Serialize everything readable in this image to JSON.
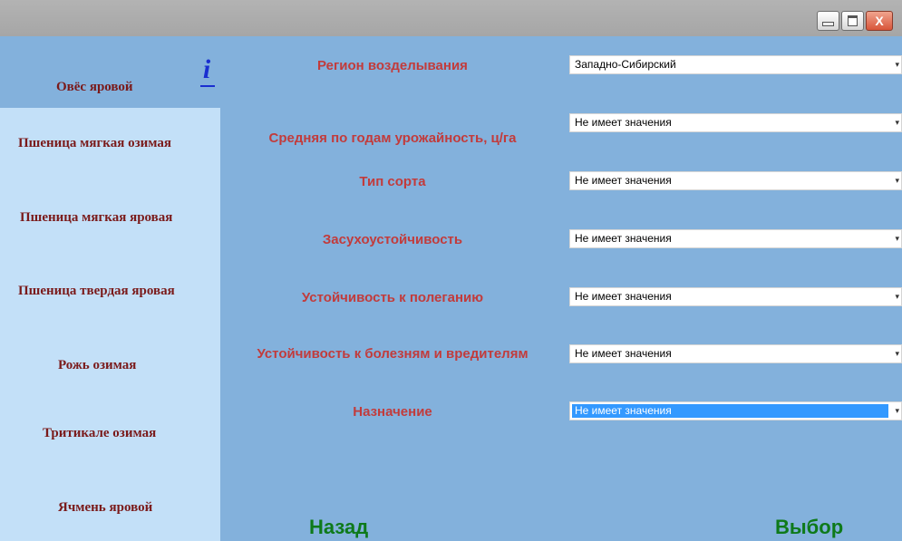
{
  "window": {
    "minimize_label": "",
    "maximize_label": "",
    "close_label": "X"
  },
  "sidebar": {
    "info_label": "i",
    "items": [
      {
        "label": "Овёс яровой",
        "selected": true
      },
      {
        "label": "Пшеница мягкая озимая",
        "selected": false
      },
      {
        "label": "Пшеница мягкая яровая",
        "selected": false
      },
      {
        "label": "Пшеница твердая яровая",
        "selected": false
      },
      {
        "label": "Рожь озимая",
        "selected": false
      },
      {
        "label": "Тритикале озимая",
        "selected": false
      },
      {
        "label": "Ячмень яровой",
        "selected": false
      }
    ]
  },
  "params": [
    {
      "label": "Регион возделывания",
      "value": "Западно-Сибирский"
    },
    {
      "label": "Средняя по годам урожайность, ц/га",
      "value": "Не имеет значения"
    },
    {
      "label": "Тип сорта",
      "value": "Не имеет значения"
    },
    {
      "label": "Засухоустойчивость",
      "value": "Не имеет значения"
    },
    {
      "label": "Устойчивость к полеганию",
      "value": "Не имеет значения"
    },
    {
      "label": "Устойчивость к болезням и вредителям",
      "value": "Не имеет значения"
    },
    {
      "label": "Назначение",
      "value": "Не имеет значения",
      "focused": true
    }
  ],
  "footer": {
    "back_label": "Назад",
    "select_label": "Выбор"
  },
  "colors": {
    "background": "#83b1dc",
    "sidebar": "#c3e0f8",
    "label_text": "#c23b3b",
    "sidebar_text": "#7a1a1a",
    "nav_text": "#0e7a1a",
    "highlight": "#3399ff"
  }
}
